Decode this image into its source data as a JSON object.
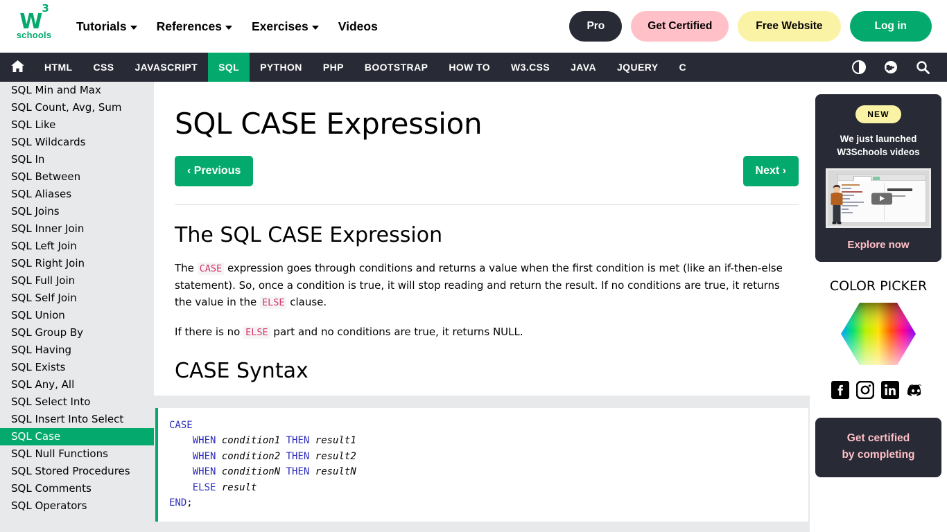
{
  "header": {
    "logo": {
      "mark": "W",
      "sup": "3",
      "text": "schools"
    },
    "nav": [
      {
        "label": "Tutorials",
        "caret": true
      },
      {
        "label": "References",
        "caret": true
      },
      {
        "label": "Exercises",
        "caret": true
      },
      {
        "label": "Videos",
        "caret": false
      }
    ],
    "buttons": {
      "pro": "Pro",
      "get_certified": "Get Certified",
      "free_website": "Free Website",
      "log_in": "Log in"
    },
    "colors": {
      "pro_bg": "#282A35",
      "certified_bg": "#FFC0C7",
      "free_bg": "#FAF3A6",
      "login_bg": "#04AA6D"
    }
  },
  "navbar": {
    "home_icon": "home-icon",
    "items": [
      {
        "label": "HTML",
        "active": false
      },
      {
        "label": "CSS",
        "active": false
      },
      {
        "label": "JAVASCRIPT",
        "active": false
      },
      {
        "label": "SQL",
        "active": true
      },
      {
        "label": "PYTHON",
        "active": false
      },
      {
        "label": "PHP",
        "active": false
      },
      {
        "label": "BOOTSTRAP",
        "active": false
      },
      {
        "label": "HOW TO",
        "active": false
      },
      {
        "label": "W3.CSS",
        "active": false
      },
      {
        "label": "JAVA",
        "active": false
      },
      {
        "label": "JQUERY",
        "active": false
      },
      {
        "label": "C",
        "active": false
      }
    ],
    "icons": [
      "dark-mode-icon",
      "translate-globe-icon",
      "search-icon"
    ],
    "bg": "#282A35",
    "active_bg": "#04AA6D"
  },
  "sidebar": {
    "active_bg": "#04AA6D",
    "items": [
      {
        "label": "SQL Min and Max",
        "active": false
      },
      {
        "label": "SQL Count, Avg, Sum",
        "active": false
      },
      {
        "label": "SQL Like",
        "active": false
      },
      {
        "label": "SQL Wildcards",
        "active": false
      },
      {
        "label": "SQL In",
        "active": false
      },
      {
        "label": "SQL Between",
        "active": false
      },
      {
        "label": "SQL Aliases",
        "active": false
      },
      {
        "label": "SQL Joins",
        "active": false
      },
      {
        "label": "SQL Inner Join",
        "active": false
      },
      {
        "label": "SQL Left Join",
        "active": false
      },
      {
        "label": "SQL Right Join",
        "active": false
      },
      {
        "label": "SQL Full Join",
        "active": false
      },
      {
        "label": "SQL Self Join",
        "active": false
      },
      {
        "label": "SQL Union",
        "active": false
      },
      {
        "label": "SQL Group By",
        "active": false
      },
      {
        "label": "SQL Having",
        "active": false
      },
      {
        "label": "SQL Exists",
        "active": false
      },
      {
        "label": "SQL Any, All",
        "active": false
      },
      {
        "label": "SQL Select Into",
        "active": false
      },
      {
        "label": "SQL Insert Into Select",
        "active": false
      },
      {
        "label": "SQL Case",
        "active": true
      },
      {
        "label": "SQL Null Functions",
        "active": false
      },
      {
        "label": "SQL Stored Procedures",
        "active": false
      },
      {
        "label": "SQL Comments",
        "active": false
      },
      {
        "label": "SQL Operators",
        "active": false
      }
    ]
  },
  "main": {
    "title": "SQL CASE Expression",
    "previous_label": "‹ Previous",
    "next_label": "Next ›",
    "section1_title": "The SQL CASE Expression",
    "paragraph1": {
      "part1": "The ",
      "code1": "CASE",
      "part2": " expression goes through conditions and returns a value when the first condition is met (like an if-then-else statement). So, once a condition is true, it will stop reading and return the result. If no conditions are true, it returns the value in the ",
      "code2": "ELSE",
      "part3": " clause."
    },
    "paragraph2": {
      "part1": "If there is no ",
      "code1": "ELSE",
      "part2": " part and no conditions are true, it returns NULL."
    },
    "section2_title": "CASE Syntax",
    "code_block": {
      "lines": [
        [
          {
            "t": "CASE",
            "k": true
          }
        ],
        [
          {
            "t": "    ",
            "k": false
          },
          {
            "t": "WHEN",
            "k": true
          },
          {
            "t": " ",
            "k": false
          },
          {
            "t": "condition1",
            "i": true
          },
          {
            "t": " ",
            "k": false
          },
          {
            "t": "THEN",
            "k": true
          },
          {
            "t": " ",
            "k": false
          },
          {
            "t": "result1",
            "i": true
          }
        ],
        [
          {
            "t": "    ",
            "k": false
          },
          {
            "t": "WHEN",
            "k": true
          },
          {
            "t": " ",
            "k": false
          },
          {
            "t": "condition2",
            "i": true
          },
          {
            "t": " ",
            "k": false
          },
          {
            "t": "THEN",
            "k": true
          },
          {
            "t": " ",
            "k": false
          },
          {
            "t": "result2",
            "i": true
          }
        ],
        [
          {
            "t": "    ",
            "k": false
          },
          {
            "t": "WHEN",
            "k": true
          },
          {
            "t": " ",
            "k": false
          },
          {
            "t": "conditionN",
            "i": true
          },
          {
            "t": " ",
            "k": false
          },
          {
            "t": "THEN",
            "k": true
          },
          {
            "t": " ",
            "k": false
          },
          {
            "t": "resultN",
            "i": true
          }
        ],
        [
          {
            "t": "    ",
            "k": false
          },
          {
            "t": "ELSE",
            "k": true
          },
          {
            "t": " ",
            "k": false
          },
          {
            "t": "result",
            "i": true
          }
        ],
        [
          {
            "t": "END",
            "k": true
          },
          {
            "t": ";",
            "k": false
          }
        ]
      ],
      "accent": "#04AA6D"
    }
  },
  "rightbar": {
    "promo": {
      "badge": "NEW",
      "line1": "We just launched",
      "line2": "W3Schools videos",
      "cta": "Explore now",
      "badge_bg": "#FAF3A6",
      "card_bg": "#282A35",
      "cta_color": "#FFC0C7"
    },
    "color_picker_title": "COLOR PICKER",
    "socials": [
      "facebook-icon",
      "instagram-icon",
      "linkedin-icon",
      "discord-icon"
    ],
    "cert_card": {
      "line1": "Get certified",
      "line2": "by completing",
      "text_color": "#FFC0C7"
    }
  }
}
